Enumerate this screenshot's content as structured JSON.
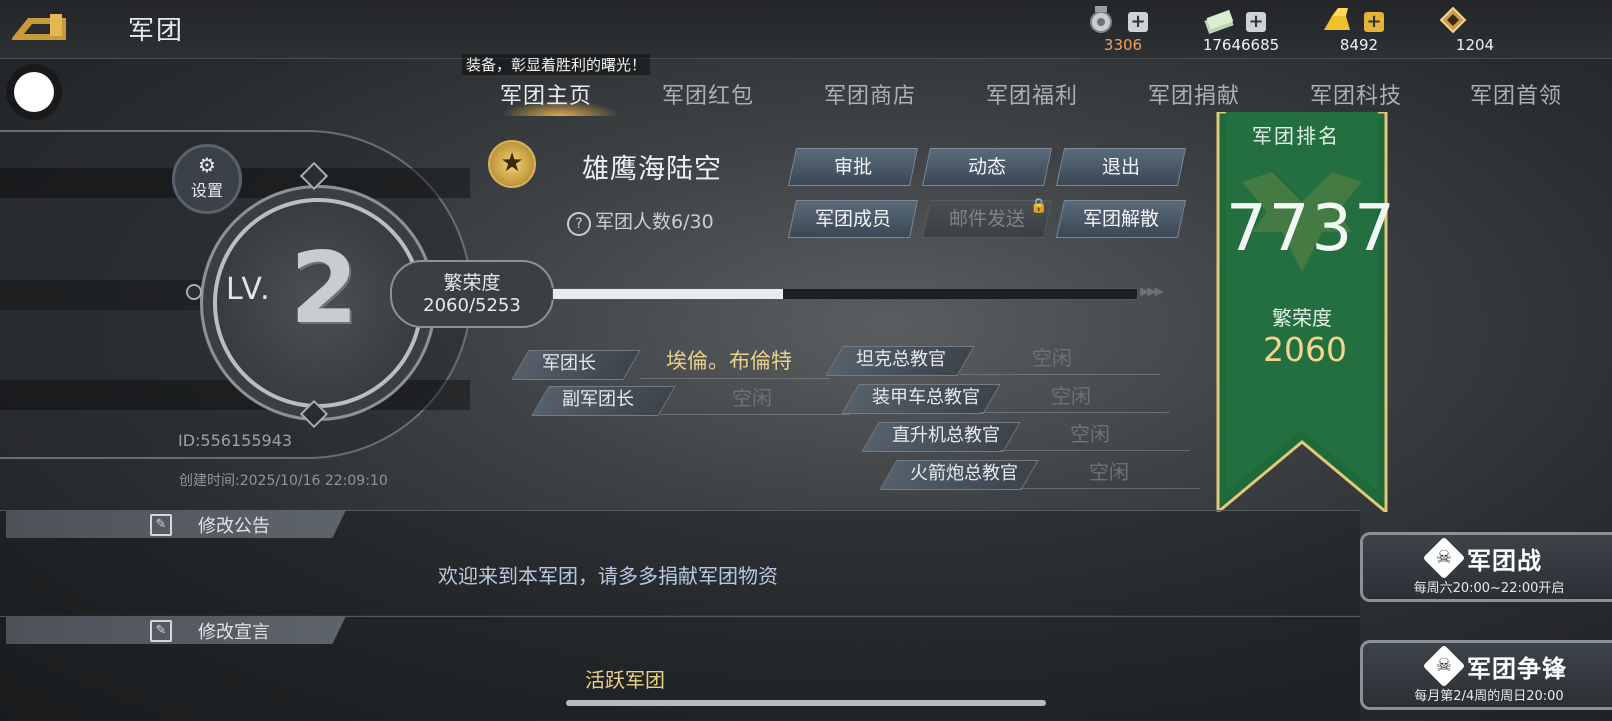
{
  "header": {
    "title": "军团",
    "resources": [
      {
        "icon": "medal-icon",
        "value": "3306",
        "color": "#f1a15a"
      },
      {
        "icon": "cash-icon",
        "value": "17646685",
        "color": "#ffffff"
      },
      {
        "icon": "gold-bar-icon",
        "value": "8492",
        "color": "#ffffff"
      },
      {
        "icon": "crystal-icon",
        "value": "1204",
        "color": "#ffffff"
      }
    ],
    "plus_label": "+",
    "marquee": "装备，彰显着胜利的曙光！"
  },
  "tabs": [
    {
      "label": "军团主页",
      "active": true
    },
    {
      "label": "军团红包"
    },
    {
      "label": "军团商店"
    },
    {
      "label": "军团福利"
    },
    {
      "label": "军团捐献"
    },
    {
      "label": "军团科技"
    },
    {
      "label": "军团首领"
    }
  ],
  "level": {
    "label": "LV.",
    "number": "2",
    "settings_label": "设置",
    "id_text": "ID:556155943",
    "created_text": "创建时间:2025/10/16 22:09:10"
  },
  "prosperity": {
    "label": "繁荣度",
    "value_text": "2060/5253",
    "current": 2060,
    "max": 5253
  },
  "legion": {
    "name": "雄鹰海陆空",
    "member_count": "军团人数6/30",
    "buttons": {
      "approve": "审批",
      "activity": "动态",
      "quit": "退出",
      "members": "军团成员",
      "mail": "邮件发送",
      "disband": "军团解散"
    }
  },
  "officers": {
    "leader_role": "军团长",
    "leader_name": "埃倫。布倫特",
    "deputy_role": "副军团长",
    "deputy_name": "空闲",
    "tank_role": "坦克总教官",
    "tank_name": "空闲",
    "apc_role": "装甲车总教官",
    "apc_name": "空闲",
    "heli_role": "直升机总教官",
    "heli_name": "空闲",
    "rocket_role": "火箭炮总教官",
    "rocket_name": "空闲"
  },
  "ranking": {
    "title": "军团排名",
    "value": "7737",
    "pros_label": "繁荣度",
    "pros_value": "2060",
    "color": "#1f6a3a"
  },
  "announcement": {
    "edit_label": "修改公告",
    "text": "欢迎来到本军团，请多多捐献军团物资"
  },
  "declaration": {
    "edit_label": "修改宣言",
    "text": "活跃军团"
  },
  "war": {
    "legion_war_title": "军团战",
    "legion_war_time": "每周六20:00~22:00开启",
    "legion_contest_title": "军团争锋",
    "legion_contest_time": "每月第2/4周的周日20:00"
  }
}
